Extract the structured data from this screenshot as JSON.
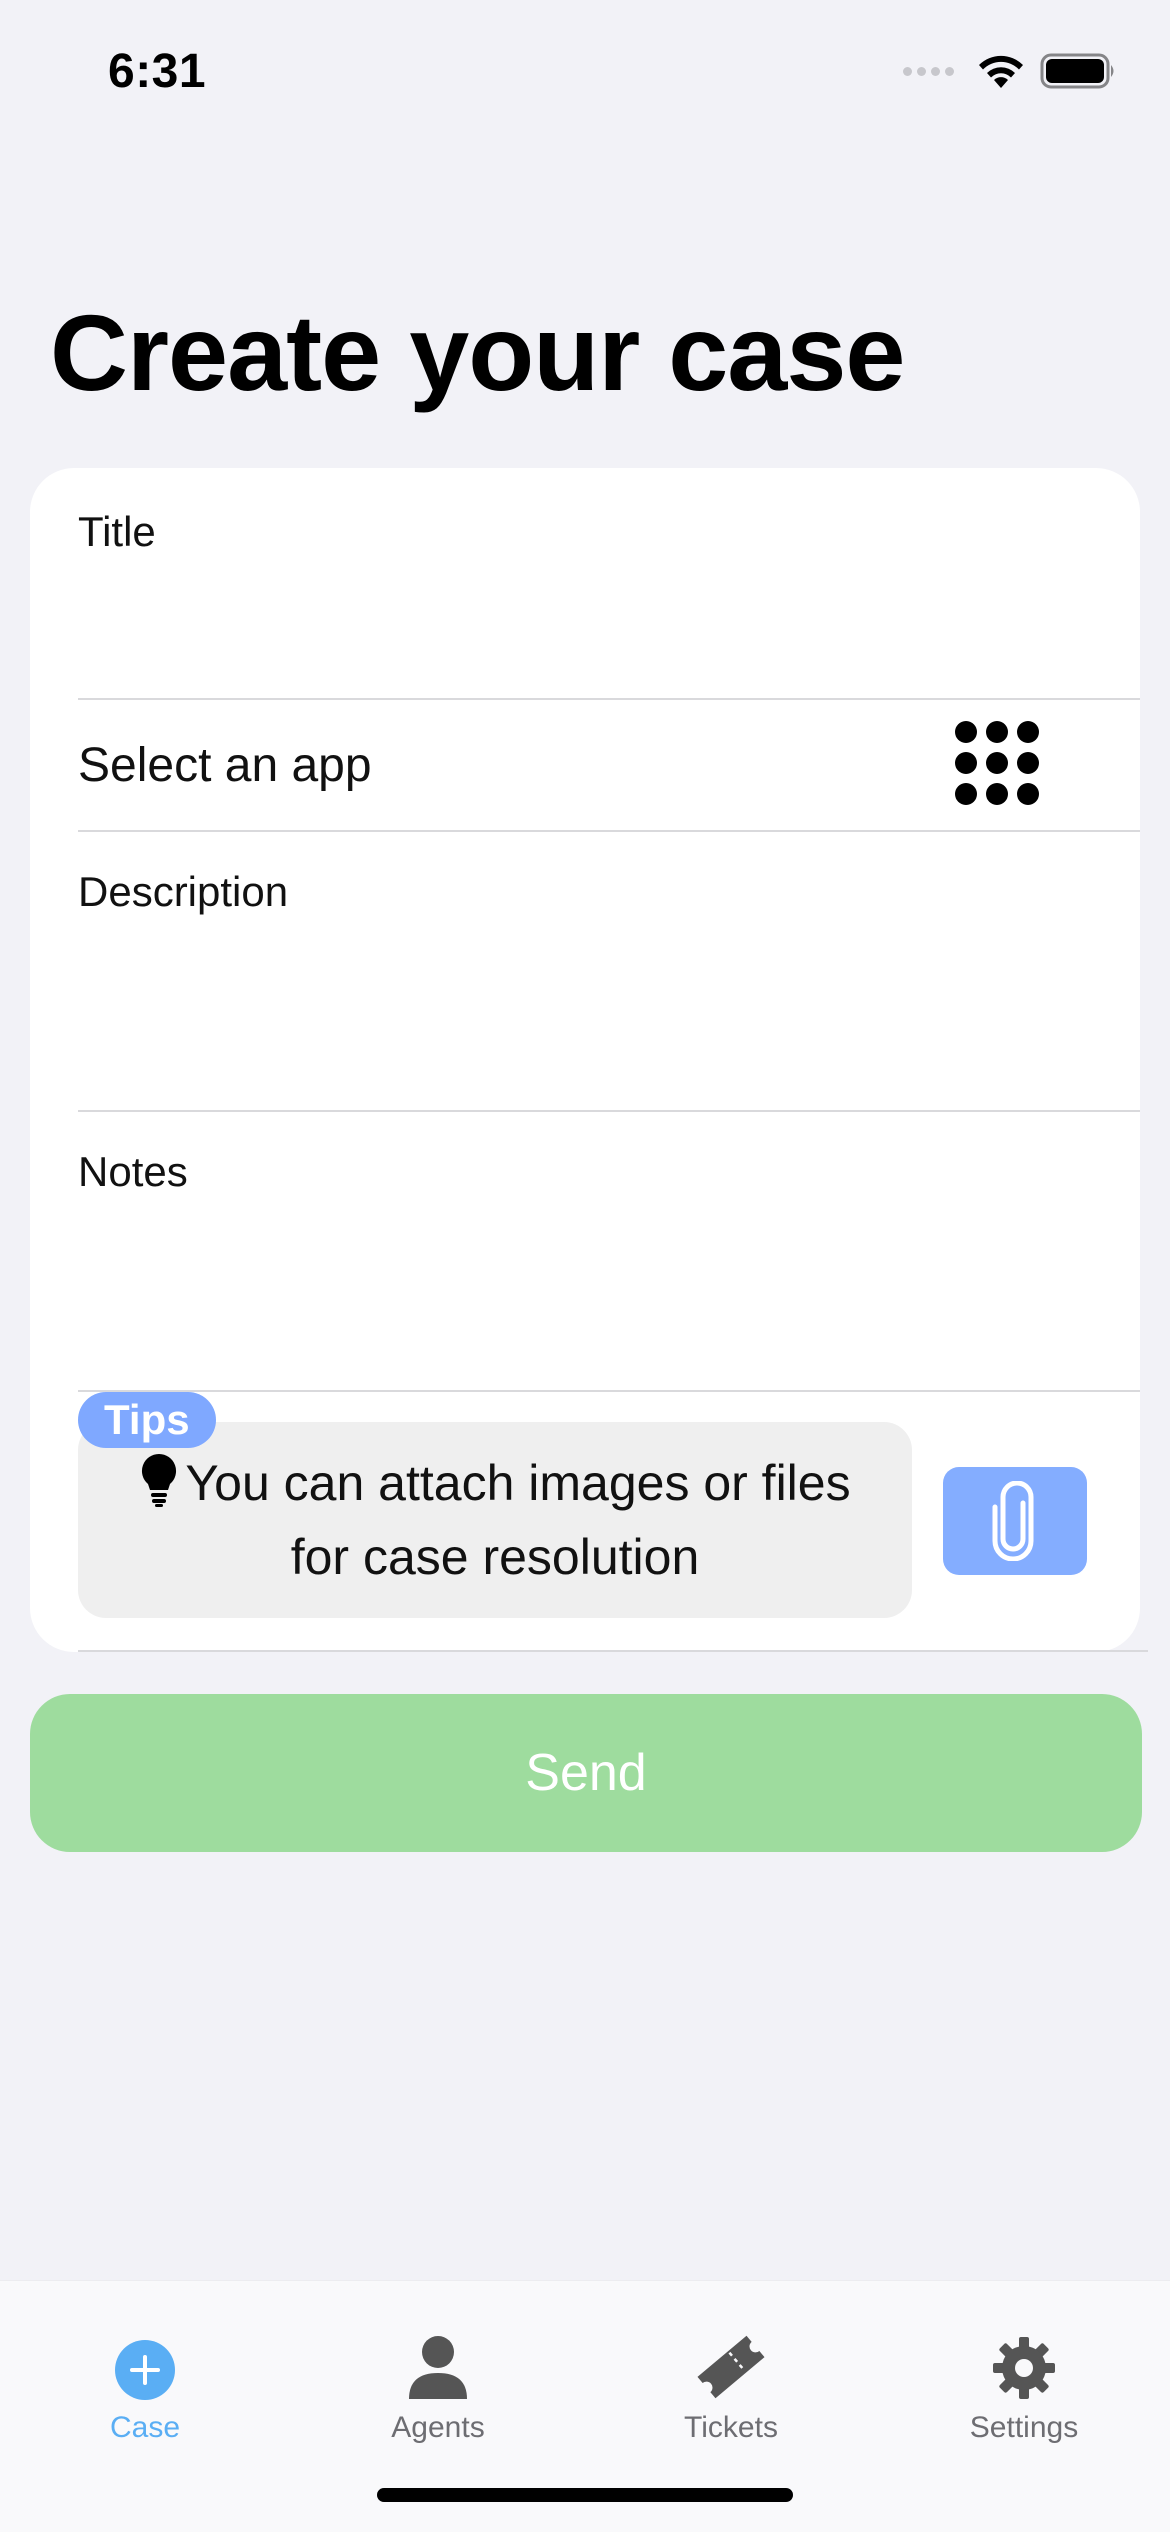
{
  "status_bar": {
    "time": "6:31"
  },
  "page": {
    "title": "Create your case"
  },
  "form": {
    "title_label": "Title",
    "app_label": "Select an app",
    "description_label": "Description",
    "notes_label": "Notes"
  },
  "tips": {
    "badge": "Tips",
    "text": "You can attach images or files for case resolution"
  },
  "send_button": {
    "label": "Send",
    "color": "#9edc9e"
  },
  "tab_bar": {
    "active_color": "#5aaef4",
    "tabs": [
      {
        "label": "Case",
        "icon": "plus-circle-icon",
        "active": true
      },
      {
        "label": "Agents",
        "icon": "person-icon",
        "active": false
      },
      {
        "label": "Tickets",
        "icon": "ticket-icon",
        "active": false
      },
      {
        "label": "Settings",
        "icon": "gear-icon",
        "active": false
      }
    ]
  },
  "colors": {
    "background": "#f2f2f7",
    "tips_badge": "#7fa8ff",
    "attach_button": "#84adff"
  }
}
